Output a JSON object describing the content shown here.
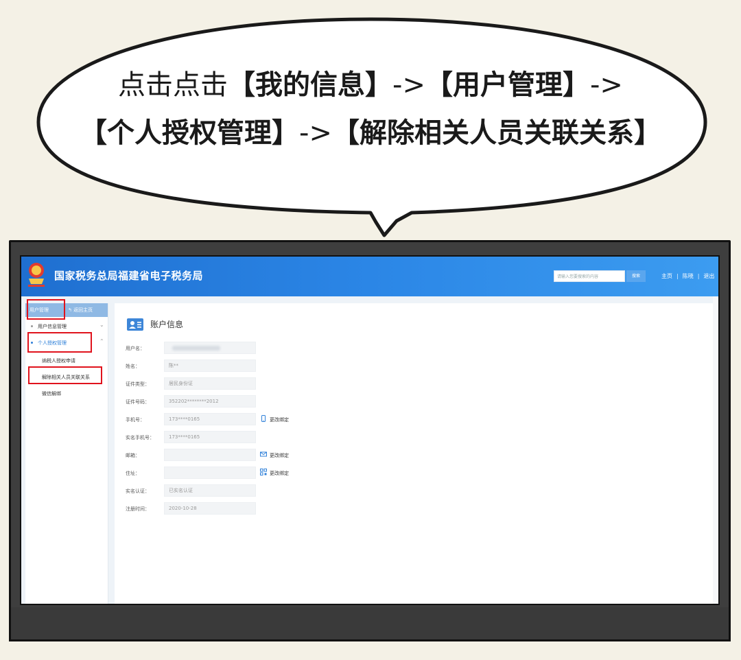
{
  "bubble": {
    "line1_prefix": "点击点击",
    "line1_b1": "【我的信息】",
    "line1_arrow1": "->",
    "line1_b2": "【用户管理】",
    "line1_arrow2": "->",
    "line2_b1": "【个人授权管理】",
    "line2_arrow": "->",
    "line2_b2": "【解除相关人员关联关系】"
  },
  "header": {
    "site_title": "国家税务总局福建省电子税务局",
    "search_placeholder": "请输入您要搜索的内容",
    "search_button": "搜索",
    "links": [
      "主页",
      "陈晓",
      "退出"
    ]
  },
  "sidebar": {
    "head_title": "用户管理",
    "back_label": "返回主页",
    "items": [
      {
        "label": "用户信息管理"
      },
      {
        "label": "个人授权管理"
      }
    ],
    "subitems": [
      {
        "label": "纳税人授权申请"
      },
      {
        "label": "解除相关人员关联关系"
      },
      {
        "label": "微信解绑"
      }
    ]
  },
  "main": {
    "title": "账户信息",
    "fields": [
      {
        "label": "用户名：",
        "value": ""
      },
      {
        "label": "姓名：",
        "value": "陈**"
      },
      {
        "label": "证件类型：",
        "value": "居民身份证"
      },
      {
        "label": "证件号码：",
        "value": "352202********2012"
      },
      {
        "label": "手机号：",
        "value": "173****0165",
        "action": "更改绑定"
      },
      {
        "label": "实名手机号：",
        "value": "173****0165"
      },
      {
        "label": "邮箱：",
        "value": "",
        "action": "更改绑定"
      },
      {
        "label": "住址：",
        "value": "",
        "action": "更改绑定"
      },
      {
        "label": "实名认证：",
        "value": "已实名认证"
      },
      {
        "label": "注册时间：",
        "value": "2020-10-28"
      }
    ]
  },
  "colors": {
    "header_blue": "#2b86e6",
    "highlight_red": "#e0121c",
    "accent_blue": "#2d7fd8"
  }
}
